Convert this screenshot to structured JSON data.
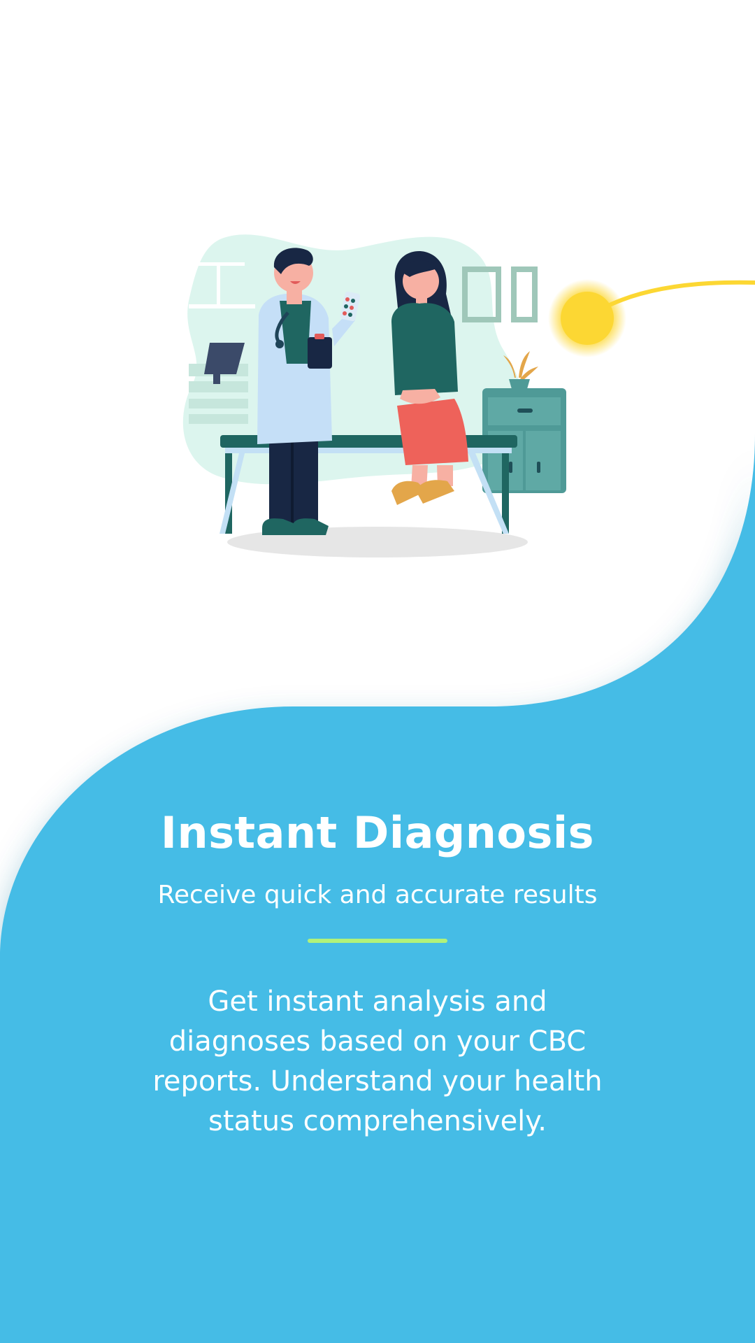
{
  "onboarding": {
    "title": "Instant Diagnosis",
    "subtitle": "Receive quick and accurate results",
    "description": "Get instant analysis and diagnoses based on your CBC reports. Understand your health status comprehensively."
  },
  "illustration": {
    "subject": "doctor-consulting-patient",
    "icon": "doctor-patient-illustration"
  },
  "colors": {
    "background": "#ffffff",
    "accent_blue": "#45bce6",
    "divider_green": "#b0f27a",
    "sun_yellow": "#fcd733",
    "text_light": "#ffffff"
  }
}
